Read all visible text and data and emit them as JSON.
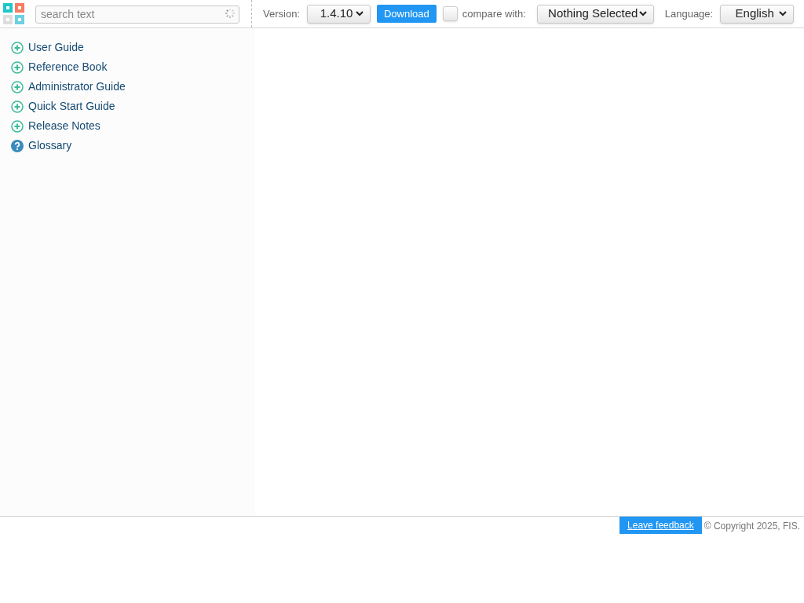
{
  "search": {
    "placeholder": "search text"
  },
  "toolbar": {
    "version_label": "Version:",
    "version": "1.4.10",
    "download": "Download",
    "compare": {
      "checked": false,
      "label": "compare with:",
      "value": "Nothing Selected"
    },
    "language_label": "Language:",
    "language": "English"
  },
  "sidebar": {
    "items": [
      {
        "label": "User Guide",
        "kind": "expandable"
      },
      {
        "label": "Reference Book",
        "kind": "expandable"
      },
      {
        "label": "Administrator Guide",
        "kind": "expandable"
      },
      {
        "label": "Quick Start Guide",
        "kind": "expandable"
      },
      {
        "label": "Release Notes",
        "kind": "expandable"
      },
      {
        "label": "Glossary",
        "kind": "help"
      }
    ]
  },
  "footer": {
    "feedback": "Leave feedback",
    "copyright": "© Copyright 2025, FIS."
  }
}
